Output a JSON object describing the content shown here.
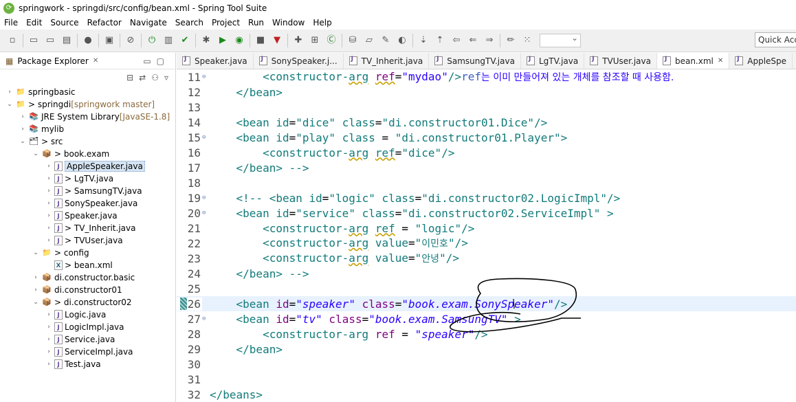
{
  "window": {
    "title": "springwork - springdi/src/config/bean.xml - Spring Tool Suite"
  },
  "menu": [
    "File",
    "Edit",
    "Source",
    "Refactor",
    "Navigate",
    "Search",
    "Project",
    "Run",
    "Window",
    "Help"
  ],
  "toolbar": {
    "quick_access": "Quick Access"
  },
  "package_explorer": {
    "title": "Package Explorer",
    "items": [
      {
        "label": "springbasic",
        "indent": 0,
        "arrow": "›",
        "icon": "📁",
        "deco": ""
      },
      {
        "label": "> springdi",
        "indent": 0,
        "arrow": "⌄",
        "icon": "📁",
        "deco": " [springwork master]"
      },
      {
        "label": "JRE System Library",
        "indent": 1,
        "arrow": "›",
        "icon": "📚",
        "deco": " [JavaSE-1.8]"
      },
      {
        "label": "mylib",
        "indent": 1,
        "arrow": "›",
        "icon": "📚",
        "deco": ""
      },
      {
        "label": "> src",
        "indent": 1,
        "arrow": "⌄",
        "icon": "🗂",
        "deco": ""
      },
      {
        "label": "> book.exam",
        "indent": 2,
        "arrow": "⌄",
        "icon": "📦",
        "deco": ""
      },
      {
        "label": "AppleSpeaker.java",
        "indent": 3,
        "arrow": "›",
        "icon": "J",
        "deco": "",
        "selected": true
      },
      {
        "label": "> LgTV.java",
        "indent": 3,
        "arrow": "›",
        "icon": "J",
        "deco": ""
      },
      {
        "label": "> SamsungTV.java",
        "indent": 3,
        "arrow": "›",
        "icon": "J",
        "deco": ""
      },
      {
        "label": "SonySpeaker.java",
        "indent": 3,
        "arrow": "›",
        "icon": "J",
        "deco": ""
      },
      {
        "label": "Speaker.java",
        "indent": 3,
        "arrow": "›",
        "icon": "J",
        "deco": ""
      },
      {
        "label": "> TV_Inherit.java",
        "indent": 3,
        "arrow": "›",
        "icon": "J",
        "deco": ""
      },
      {
        "label": "> TVUser.java",
        "indent": 3,
        "arrow": "›",
        "icon": "J",
        "deco": ""
      },
      {
        "label": "> config",
        "indent": 2,
        "arrow": "⌄",
        "icon": "📁",
        "deco": ""
      },
      {
        "label": "> bean.xml",
        "indent": 3,
        "arrow": "",
        "icon": "X",
        "deco": ""
      },
      {
        "label": "di.constructor.basic",
        "indent": 2,
        "arrow": "›",
        "icon": "📦",
        "deco": ""
      },
      {
        "label": "di.constructor01",
        "indent": 2,
        "arrow": "›",
        "icon": "📦",
        "deco": ""
      },
      {
        "label": "> di.constructor02",
        "indent": 2,
        "arrow": "⌄",
        "icon": "📦",
        "deco": ""
      },
      {
        "label": "Logic.java",
        "indent": 3,
        "arrow": "›",
        "icon": "J",
        "deco": ""
      },
      {
        "label": "LogicImpl.java",
        "indent": 3,
        "arrow": "›",
        "icon": "J",
        "deco": ""
      },
      {
        "label": "Service.java",
        "indent": 3,
        "arrow": "›",
        "icon": "J",
        "deco": ""
      },
      {
        "label": "ServiceImpl.java",
        "indent": 3,
        "arrow": "›",
        "icon": "J",
        "deco": ""
      },
      {
        "label": "Test.java",
        "indent": 3,
        "arrow": "›",
        "icon": "J",
        "deco": ""
      }
    ]
  },
  "editor_tabs": [
    {
      "label": "Speaker.java",
      "icon": "java"
    },
    {
      "label": "SonySpeaker.j...",
      "icon": "java"
    },
    {
      "label": "TV_Inherit.java",
      "icon": "java"
    },
    {
      "label": "SamsungTV.java",
      "icon": "java"
    },
    {
      "label": "LgTV.java",
      "icon": "java"
    },
    {
      "label": "TVUser.java",
      "icon": "java"
    },
    {
      "label": "bean.xml",
      "icon": "xml",
      "active": true
    },
    {
      "label": "AppleSpe",
      "icon": "java"
    }
  ],
  "code_lines": [
    {
      "n": "11",
      "fold": "⊖",
      "html": "        <span class='tag'>&lt;constructor-<span class='wav'>arg</span></span> <span class='attr wav'>ref</span>=<span class='val'>\"mydao\"</span><span class='tag'>/&gt;</span><span class='cmt'>ref</span><span class='kor'>는 이미 만들어져 있는 개체를 참조할 때 사용함.</span>"
    },
    {
      "n": "12",
      "fold": "",
      "html": "    <span class='tag'>&lt;/bean&gt;</span>"
    },
    {
      "n": "13",
      "fold": "",
      "html": ""
    },
    {
      "n": "14",
      "fold": "",
      "html": "    <span class='tag'>&lt;bean</span> <span class='tag'>id</span>=<span class='tag'>\"dice\"</span> <span class='tag'>class</span>=<span class='tag'>\"di.constructor01.Dice\"</span><span class='tag'>/&gt;</span>"
    },
    {
      "n": "15",
      "fold": "⊖",
      "html": "    <span class='tag'>&lt;bean</span> <span class='tag'>id</span>=<span class='tag'>\"play\"</span> <span class='tag'>class</span> = <span class='tag'>\"di.constructor01.Player\"</span><span class='tag'>&gt;</span>"
    },
    {
      "n": "16",
      "fold": "",
      "html": "        <span class='tag'>&lt;constructor-<span class='wav'>arg</span></span> <span class='tag wav'>ref</span>=<span class='tag'>\"dice\"</span><span class='tag'>/&gt;</span>"
    },
    {
      "n": "17",
      "fold": "",
      "html": "    <span class='tag'>&lt;/bean&gt; --&gt;</span>"
    },
    {
      "n": "18",
      "fold": "",
      "html": ""
    },
    {
      "n": "19",
      "fold": "⊖",
      "html": "    <span class='tag'>&lt;!-- &lt;bean</span> <span class='tag'>id</span>=<span class='tag'>\"logic\"</span> <span class='tag'>class</span>=<span class='tag'>\"di.constructor02.LogicImpl\"</span><span class='tag'>/&gt;</span>"
    },
    {
      "n": "20",
      "fold": "⊖",
      "html": "    <span class='tag'>&lt;bean</span> <span class='tag'>id</span>=<span class='tag'>\"service\"</span> <span class='tag'>class</span>=<span class='tag'>\"di.constructor02.ServiceImpl\"</span> <span class='tag'>&gt;</span>"
    },
    {
      "n": "21",
      "fold": "",
      "html": "        <span class='tag'>&lt;constructor-<span class='wav'>arg</span></span> <span class='tag wav'>ref</span> = <span class='tag'>\"logic\"</span><span class='tag'>/&gt;</span>"
    },
    {
      "n": "22",
      "fold": "",
      "html": "        <span class='tag'>&lt;constructor-<span class='wav'>arg</span></span> <span class='tag'>value</span>=<span class='tag'>\"</span><span class='kor' style='color:#127a7a'>이민호</span><span class='tag'>\"/&gt;</span>"
    },
    {
      "n": "23",
      "fold": "",
      "html": "        <span class='tag'>&lt;constructor-<span class='wav'>arg</span></span> <span class='tag'>value</span>=<span class='tag'>\"</span><span class='kor' style='color:#127a7a'>안녕</span><span class='tag'>\"/&gt;</span>"
    },
    {
      "n": "24",
      "fold": "",
      "html": "    <span class='tag'>&lt;/bean&gt; --&gt;</span>"
    },
    {
      "n": "25",
      "fold": "",
      "html": ""
    },
    {
      "n": "26",
      "fold": "",
      "cur": true,
      "html": "    <span class='tag'>&lt;bean</span> <span class='attr'>id</span>=<span class='val ital'>\"speaker\"</span> <span class='attr'>class</span>=<span class='val ital'>\"book.exam.SonySpeaker\"</span><span class='tag'>/&gt;</span>"
    },
    {
      "n": "27",
      "fold": "⊖",
      "html": "    <span class='tag'>&lt;bean</span> <span class='attr'>id</span>=<span class='val ital'>\"tv\"</span> <span class='attr'>class</span>=<span class='val ital'>\"book.exam.SamsungTV\"</span> <span class='tag'>&gt;</span>"
    },
    {
      "n": "28",
      "fold": "",
      "html": "        <span class='tag'>&lt;constructor-arg</span> <span class='attr'>ref</span> = <span class='val ital'>\"speaker\"</span><span class='tag'>/&gt;</span>"
    },
    {
      "n": "29",
      "fold": "",
      "html": "    <span class='tag'>&lt;/bean&gt;</span>"
    },
    {
      "n": "30",
      "fold": "",
      "html": ""
    },
    {
      "n": "31",
      "fold": "",
      "html": ""
    },
    {
      "n": "32",
      "fold": "",
      "html": "<span class='tag'>&lt;/beans&gt;</span>"
    }
  ]
}
